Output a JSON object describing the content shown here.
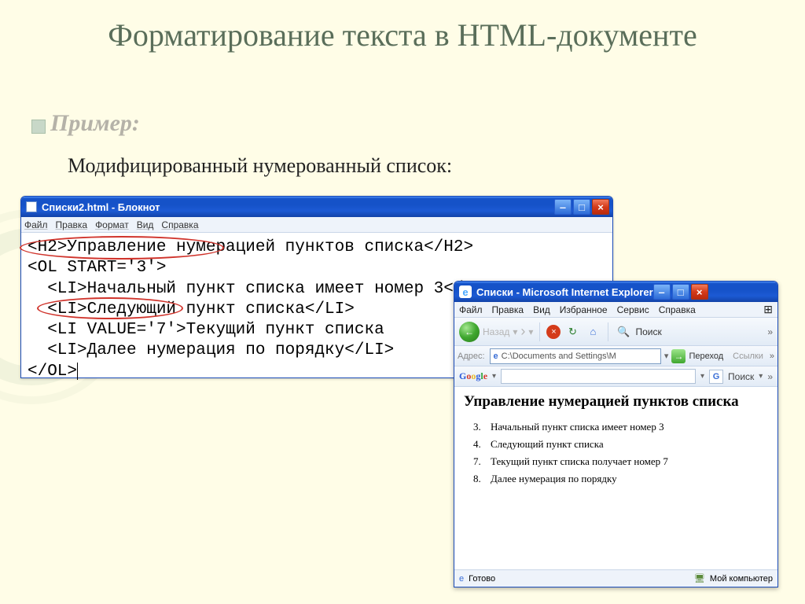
{
  "slide": {
    "title": "Форматирование текста в HTML-документе",
    "example_label": "Пример:",
    "subdesc": "Модифицированный нумерованный список:"
  },
  "notepad": {
    "title": "Списки2.html - Блокнот",
    "menu": {
      "file": "Файл",
      "edit": "Правка",
      "format": "Формат",
      "view": "Вид",
      "help": "Справка"
    },
    "code": {
      "l1": "<H2>Управление нумерацией пунктов списка</H2>",
      "l2": "<OL START='3'>",
      "l3": "  <LI>Начальный пункт списка имеет номер 3</LI>",
      "l4": "  <LI>Следующий пункт списка</LI>",
      "l5": "  <LI VALUE='7'>Текущий пункт списка",
      "l6": "  <LI>Далее нумерация по порядку</LI>",
      "l7": "</OL>"
    }
  },
  "ie": {
    "title": "Списки - Microsoft Internet Explorer",
    "menu": {
      "file": "Файл",
      "edit": "Правка",
      "view": "Вид",
      "favorites": "Избранное",
      "tools": "Сервис",
      "help": "Справка"
    },
    "toolbar": {
      "back_label": "Назад",
      "search_label": "Поиск"
    },
    "addressbar": {
      "label": "Адрес:",
      "value": "C:\\Documents and Settings\\М",
      "go_label": "Переход",
      "links_label": "Ссылки"
    },
    "googlebar": {
      "search_label": "Поиск"
    },
    "page": {
      "heading": "Управление нумерацией пунктов списка",
      "items": [
        {
          "num": "3.",
          "text": "Начальный пункт списка имеет номер 3"
        },
        {
          "num": "4.",
          "text": "Следующий пункт списка"
        },
        {
          "num": "7.",
          "text": "Текущий пункт списка получает номер 7"
        },
        {
          "num": "8.",
          "text": "Далее нумерация по порядку"
        }
      ]
    },
    "status": {
      "done": "Готово",
      "zone": "Мой компьютер"
    }
  }
}
